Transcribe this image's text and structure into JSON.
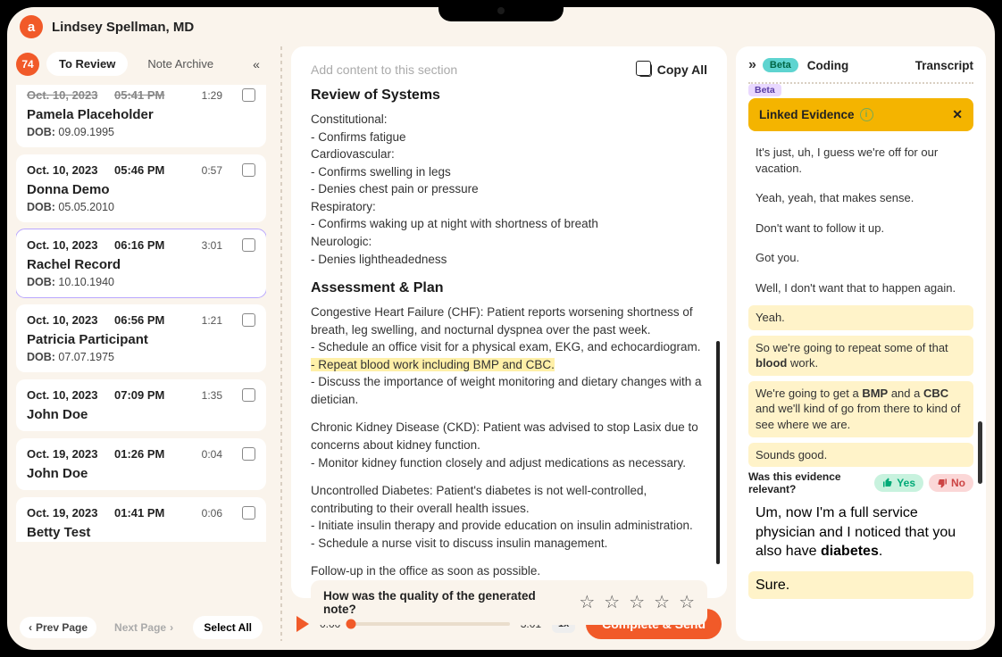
{
  "header": {
    "username": "Lindsey Spellman, MD",
    "logo_letter": "a"
  },
  "left": {
    "badge": "74",
    "tab_review": "To Review",
    "tab_archive": "Note Archive",
    "prev": "Prev Page",
    "next": "Next Page",
    "select_all": "Select All",
    "cards": [
      {
        "date": "Oct. 10, 2023",
        "time": "05:41 PM",
        "dur": "1:29",
        "name": "Pamela Placeholder",
        "dob": "09.09.1995",
        "strike": true,
        "first": true
      },
      {
        "date": "Oct. 10, 2023",
        "time": "05:46 PM",
        "dur": "0:57",
        "name": "Donna Demo",
        "dob": "05.05.2010"
      },
      {
        "date": "Oct. 10, 2023",
        "time": "06:16 PM",
        "dur": "3:01",
        "name": "Rachel Record",
        "dob": "10.10.1940",
        "selected": true
      },
      {
        "date": "Oct. 10, 2023",
        "time": "06:56 PM",
        "dur": "1:21",
        "name": "Patricia Participant",
        "dob": "07.07.1975"
      },
      {
        "date": "Oct. 10, 2023",
        "time": "07:09 PM",
        "dur": "1:35",
        "name": "John Doe",
        "slim": true
      },
      {
        "date": "Oct. 19, 2023",
        "time": "01:26 PM",
        "dur": "0:04",
        "name": "John Doe",
        "slim": true
      },
      {
        "date": "Oct. 19, 2023",
        "time": "01:41 PM",
        "dur": "0:06",
        "name": "Betty Test",
        "slim": true,
        "cut": true
      }
    ]
  },
  "note": {
    "add_placeholder": "Add content to this section",
    "copy_all": "Copy All",
    "h_ros": "Review of Systems",
    "ros_lines": [
      "Constitutional:",
      "- Confirms fatigue",
      "Cardiovascular:",
      "- Confirms swelling in legs",
      "- Denies chest pain or pressure",
      "Respiratory:",
      "- Confirms waking up at night with shortness of breath",
      "Neurologic:",
      "- Denies lightheadedness"
    ],
    "h_ap": "Assessment & Plan",
    "ap_p1a": "Congestive Heart Failure (CHF): Patient reports worsening shortness of breath, leg swelling, and nocturnal dyspnea over the past week.",
    "ap_p1b": "- Schedule an office visit for a physical exam, EKG, and echocardiogram.",
    "ap_hl": "- Repeat blood work including BMP and CBC.",
    "ap_p1c": "- Discuss the importance of weight monitoring and dietary changes with a dietician.",
    "ap_p2a": "Chronic Kidney Disease (CKD): Patient was advised to stop Lasix due to concerns about kidney function.",
    "ap_p2b": "- Monitor kidney function closely and adjust medications as necessary.",
    "ap_p3a": "Uncontrolled Diabetes: Patient's diabetes is not well-controlled, contributing to their overall health issues.",
    "ap_p3b": "- Initiate insulin therapy and provide education on insulin administration.",
    "ap_p3c": "- Schedule a nurse visit to discuss insulin management.",
    "ap_fu": "Follow-up in the office as soon as possible.",
    "rating_q": "How was the quality of the generated note?"
  },
  "player": {
    "cur": "0:00",
    "total": "3:01",
    "speed": "1x",
    "send": "Complete & Send"
  },
  "right": {
    "beta": "Beta",
    "coding": "Coding",
    "transcript": "Transcript",
    "beta2": "Beta",
    "linked": "Linked Evidence",
    "msgs": [
      {
        "t": "It's just, uh, I guess we're off for our vacation."
      },
      {
        "t": "Yeah, yeah, that makes sense."
      },
      {
        "t": "Don't want to follow it up."
      },
      {
        "t": "Got you."
      },
      {
        "t": "Well, I don't want that to happen again."
      },
      {
        "t": "Yeah.",
        "h": true
      },
      {
        "pre": "So we're going to repeat some of that ",
        "b": "blood",
        "post": " work.",
        "h": true
      },
      {
        "pre": "We're going to get a ",
        "b": "BMP",
        "mid": " and a ",
        "b2": "CBC",
        "post": " and we'll kind of go from there to kind of see where we are.",
        "h": true
      },
      {
        "t": "Sounds good.",
        "h": true
      }
    ],
    "fb_q": "Was this evidence relevant?",
    "yes": "Yes",
    "no": "No",
    "msg_after1_pre": "Um, now I'm a full service physician and I noticed that you also have ",
    "msg_after1_b": "diabetes",
    "msg_after1_post": ".",
    "msg_after2": "Sure."
  }
}
